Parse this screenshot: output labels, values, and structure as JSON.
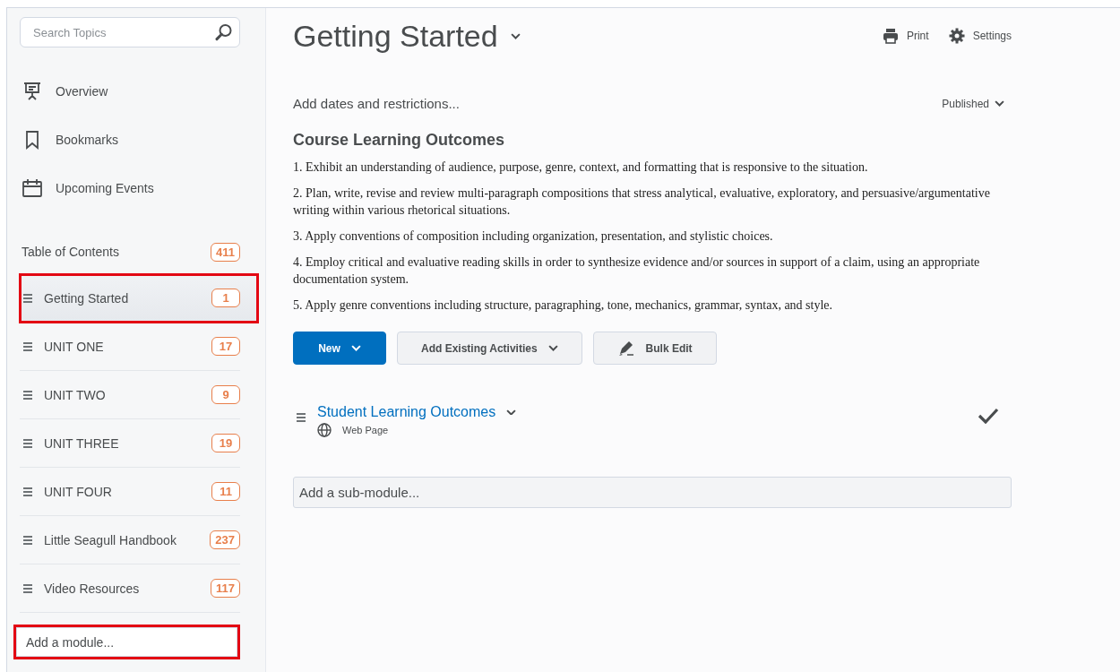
{
  "search": {
    "placeholder": "Search Topics"
  },
  "nav": [
    {
      "kind": "overview",
      "label": "Overview"
    },
    {
      "kind": "bookmarks",
      "label": "Bookmarks"
    },
    {
      "kind": "events",
      "label": "Upcoming Events"
    }
  ],
  "toc": {
    "label": "Table of Contents",
    "count": "411"
  },
  "modules": [
    {
      "label": "Getting Started",
      "count": "1",
      "selected": true,
      "highlighted": true
    },
    {
      "label": "UNIT ONE",
      "count": "17",
      "selected": false,
      "highlighted": false
    },
    {
      "label": "UNIT TWO",
      "count": "9",
      "selected": false,
      "highlighted": false
    },
    {
      "label": "UNIT THREE",
      "count": "19",
      "selected": false,
      "highlighted": false
    },
    {
      "label": "UNIT FOUR",
      "count": "11",
      "selected": false,
      "highlighted": false
    },
    {
      "label": "Little Seagull Handbook",
      "count": "237",
      "selected": false,
      "highlighted": false
    },
    {
      "label": "Video Resources",
      "count": "117",
      "selected": false,
      "highlighted": false
    }
  ],
  "add_module": {
    "placeholder": "Add a module...",
    "highlighted": true
  },
  "title": "Getting Started",
  "toolbar": [
    {
      "kind": "print",
      "label": "Print"
    },
    {
      "kind": "settings",
      "label": "Settings"
    }
  ],
  "restrictions": "Add dates and restrictions...",
  "status": "Published",
  "heading": "Course Learning Outcomes",
  "outcomes": [
    "1. Exhibit an understanding of audience, purpose, genre, context, and formatting that is responsive to the situation.",
    "2. Plan, write, revise and review multi-paragraph compositions that stress analytical, evaluative, exploratory, and persuasive/argumentative writing within various rhetorical situations.",
    "3. Apply conventions of composition including organization, presentation, and stylistic choices.",
    "4. Employ critical and evaluative reading skills in order to synthesize evidence and/or sources in support of a claim, using an appropriate documentation system.",
    "5. Apply genre conventions including structure, paragraphing, tone, mechanics, grammar, syntax, and style."
  ],
  "buttons": [
    {
      "kind": "primary",
      "label": "New"
    },
    {
      "kind": "dropdown",
      "label": "Add Existing Activities"
    },
    {
      "kind": "bulk",
      "label": "Bulk Edit"
    }
  ],
  "topics": [
    {
      "title": "Student Learning Outcomes",
      "type": "Web Page",
      "completed": true
    }
  ],
  "add_submodule": {
    "placeholder": "Add a sub-module..."
  }
}
